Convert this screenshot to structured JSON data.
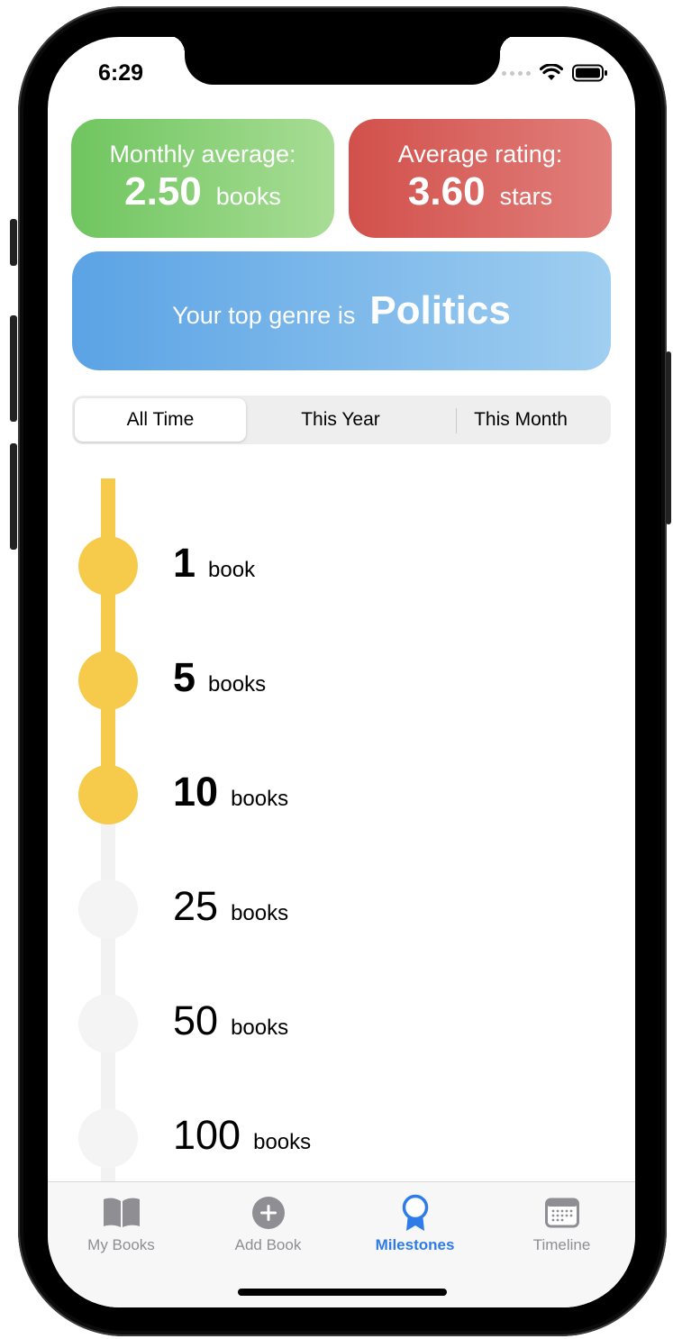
{
  "status_bar": {
    "time": "6:29"
  },
  "stats": {
    "monthly": {
      "caption": "Monthly average:",
      "value": "2.50",
      "unit": "books"
    },
    "rating": {
      "caption": "Average rating:",
      "value": "3.60",
      "unit": "stars"
    },
    "genre": {
      "lead": "Your top genre is",
      "value": "Politics"
    }
  },
  "segments": {
    "selected": "All Time",
    "options": [
      "All Time",
      "This Year",
      "This Month"
    ]
  },
  "milestones": [
    {
      "number": "1",
      "unit": "book",
      "achieved": true
    },
    {
      "number": "5",
      "unit": "books",
      "achieved": true
    },
    {
      "number": "10",
      "unit": "books",
      "achieved": true
    },
    {
      "number": "25",
      "unit": "books",
      "achieved": false
    },
    {
      "number": "50",
      "unit": "books",
      "achieved": false
    },
    {
      "number": "100",
      "unit": "books",
      "achieved": false
    }
  ],
  "tabbar": {
    "active": "Milestones",
    "tabs": [
      {
        "label": "My Books",
        "icon": "open-book-icon"
      },
      {
        "label": "Add Book",
        "icon": "plus-circle-icon"
      },
      {
        "label": "Milestones",
        "icon": "award-ribbon-icon"
      },
      {
        "label": "Timeline",
        "icon": "calendar-icon"
      }
    ]
  },
  "colors": {
    "accent_blue": "#2f7ce8",
    "milestone_done": "#f6cb4b",
    "milestone_todo": "#f4f4f4",
    "green_card": "#6fc55f",
    "red_card": "#d2504b",
    "blue_card": "#5ba3e5"
  }
}
